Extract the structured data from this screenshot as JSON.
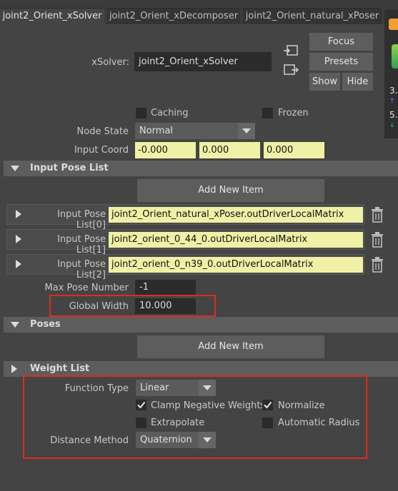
{
  "tabs": [
    {
      "label": "joint2_Orient_xSolver",
      "active": true
    },
    {
      "label": "joint2_Orient_xDecomposer",
      "active": false
    },
    {
      "label": "joint2_Orient_natural_xPoser",
      "active": false
    }
  ],
  "side_panel": {
    "value1": "3.",
    "value2": "5."
  },
  "header": {
    "xsolver_label": "xSolver:",
    "xsolver_value": "joint2_Orient_xSolver",
    "focus_label": "Focus",
    "presets_label": "Presets",
    "show_label": "Show",
    "hide_label": "Hide"
  },
  "node": {
    "caching_label": "Caching",
    "caching_checked": false,
    "frozen_label": "Frozen",
    "frozen_checked": false,
    "node_state_label": "Node State",
    "node_state_value": "Normal",
    "input_coord_label": "Input Coord",
    "input_coord_values": [
      "-0.000",
      "0.000",
      "0.000"
    ]
  },
  "input_pose_list": {
    "title": "Input Pose List",
    "add_label": "Add New Item",
    "items": [
      {
        "label": "Input Pose List[0]",
        "value": "joint2_Orient_natural_xPoser.outDriverLocalMatrix"
      },
      {
        "label": "Input Pose List[1]",
        "value": "joint2_orient_0_44_0.outDriverLocalMatrix"
      },
      {
        "label": "Input Pose List[2]",
        "value": "joint2_orient_0_n39_0.outDriverLocalMatrix"
      }
    ],
    "max_pose_label": "Max Pose Number",
    "max_pose_value": "-1",
    "global_width_label": "Global Width",
    "global_width_value": "10.000"
  },
  "poses": {
    "title": "Poses",
    "add_label": "Add New Item"
  },
  "weight_list": {
    "title": "Weight List",
    "function_type_label": "Function Type",
    "function_type_value": "Linear",
    "clamp_label": "Clamp Negative Weights",
    "clamp_checked": true,
    "normalize_label": "Normalize",
    "normalize_checked": true,
    "extrapolate_label": "Extrapolate",
    "extrapolate_checked": false,
    "automatic_radius_label": "Automatic Radius",
    "automatic_radius_checked": false,
    "distance_method_label": "Distance Method",
    "distance_method_value": "Quaternion"
  },
  "colors": {
    "background": "#444444",
    "section_header": "#5d5d5d",
    "field_yellow": "#f0f0a6",
    "highlight_red": "#e02a1e"
  }
}
